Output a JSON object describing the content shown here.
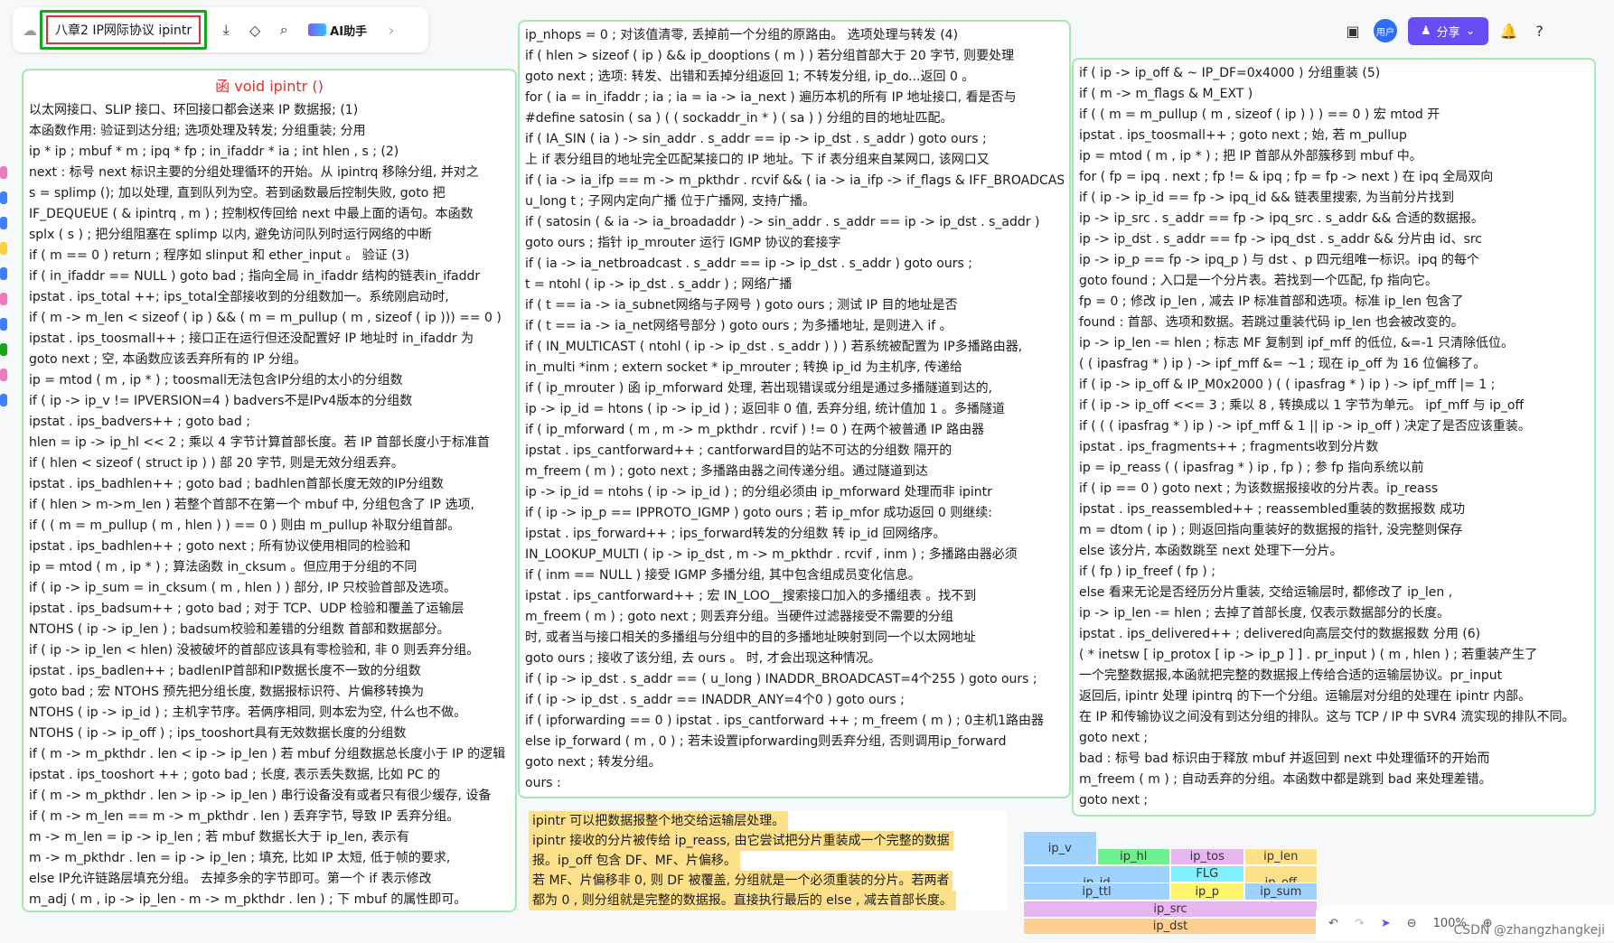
{
  "toolbar": {
    "doc_title": "八章2 IP网际协议 ipintr",
    "ai_label": "AI助手",
    "share_label": "分享",
    "avatar_label": "用户"
  },
  "zoom": "100%",
  "watermark": "CSDN @zhangzhangkeji",
  "left_card": {
    "title": "函 void  ipintr   ()",
    "lines": [
      "以太网接口、SLIP 接口、环回接口都会送来 IP 数据报;                  (1)",
      "本函数作用: 验证到达分组; 选项处理及转发; 分组重装; 分用",
      "ip * ip ; mbuf * m ; ipq * fp ; in_ifaddr * ia ; int  hlen , s ;   (2)",
      "next : 标号 next 标识主要的分组处理循环的开始。从 ipintrq 移除分组, 并对之",
      "s = splimp (); 加以处理, 直到队列为空。若到函数最后控制失败, goto 把",
      "IF_DEQUEUE ( & ipintrq , m ) ;  控制权传回给 next 中最上面的语句。本函数",
      "splx ( s ) ; 把分组阻塞在 splimp 以内, 避免访问队列时运行网络的中断",
      "if ( m == 0 )   return ;     程序如 slinput 和 ether_input  。  验证  (3)",
      "if ( in_ifaddr == NULL ) goto bad ; 指向全局 in_ifaddr 结构的链表in_ifaddr",
      "ipstat . ips_total ++;    ips_total全部接收到的分组数加一。系统刚启动时,",
      "if ( m -> m_len < sizeof ( ip ) && ( m = m_pullup ( m , sizeof ( ip ))) == 0 )",
      "   ipstat . ips_toosmall++ ; 接口正在运行但还没配置好 IP 地址时 in_ifaddr 为",
      "   goto  next ;                  空, 本函数应该丢弃所有的 IP 分组。",
      "ip = mtod ( m , ip * ) ;      toosmall无法包含IP分组的太小的分组数",
      "if ( ip -> ip_v != IPVERSION=4 )    badvers不是IPv4版本的分组数",
      "   ipstat . ips_badvers++ ;       goto  bad ;",
      "hlen = ip -> ip_hl << 2 ; 乘以 4 字节计算首部长度。若 IP 首部长度小于标准首",
      "if ( hlen < sizeof ( struct  ip ) )               部 20 字节, 则是无效分组丢弃。",
      "   ipstat . ips_badhlen++ ;   goto   bad ; badhlen首部长度无效的IP分组数",
      "if ( hlen > m->m_len ) 若整个首部不在第一个 mbuf 中, 分组包含了 IP 选项,",
      "    if ( ( m = m_pullup ( m , hlen ) ) == 0 )  则由 m_pullup 补取分组首部。",
      "      ipstat . ips_badhlen++ ;  goto  next ;   所有协议使用相同的检验和",
      "   ip = mtod ( m , ip * ) ;       算法函数 in_cksum 。但应用于分组的不同",
      "if ( ip -> ip_sum = in_cksum ( m , hlen ) ) 部分, IP 只校验首部及选项。",
      "   ipstat . ips_badsum++ ;  goto   bad ; 对于 TCP、UDP 检验和覆盖了运输层",
      "NTOHS ( ip -> ip_len ) ;   badsum校验和差错的分组数 首部和数据部分。",
      " if ( ip -> ip_len < hlen)   没被破坏的首部应该具有零检验和, 非 0 则丢弃分组。",
      "   ipstat . ips_badlen++ ;    badlenIP首部和IP数据长度不一致的分组数",
      "   goto  bad ;       宏 NTOHS 预先把分组长度, 数据报标识符、片偏移转换为",
      "NTOHS ( ip -> ip_id ) ;  主机字节序。若俩序相同, 则本宏为空, 什么也不做。",
      "NTOHS ( ip -> ip_off ) ;      ips_tooshort具有无效数据长度的分组数",
      "if ( m -> m_pkthdr . len < ip -> ip_len ) 若 mbuf 分组数据总长度小于 IP 的逻辑",
      "   ipstat . ips_tooshort ++ ;   goto   bad ; 长度, 表示丢失数据, 比如 PC 的",
      "if ( m -> m_pkthdr . len > ip -> ip_len ) 串行设备没有或者只有很少缓存, 设备",
      "   if ( m -> m_len == m -> m_pkthdr . len )  丢弃字节, 导致 IP 丢弃分组。",
      "         m -> m_len = ip -> ip_len ;    若 mbuf 数据长大于 ip_len, 表示有",
      "         m -> m_pkthdr . len = ip -> ip_len ; 填充, 比如 IP 太短, 低于帧的要求,",
      "     else        IP允许链路层填充分组。   去掉多余的字节即可。第一个 if 表示修改",
      "         m_adj ( m , ip -> ip_len - m -> m_pkthdr . len ) ; 下 mbuf 的属性即可。"
    ]
  },
  "mid_card": {
    "lines": [
      "ip_nhops = 0 ; 对该值清零, 丢掉前一个分组的原路由。        选项处理与转发 (4)",
      "if ( hlen > sizeof ( ip ) && ip_dooptions ( m ) ) 若分组首部大于 20 字节, 则要处理",
      "    goto  next ;   选项: 转发、出错和丢掉分组返回 1; 不转发分组, ip_do...返回 0 。",
      "for ( ia = in_ifaddr ; ia ; ia = ia -> ia_next ) 遍历本机的所有 IP 地址接口, 看是否与",
      "    #define  satosin ( sa ) ( ( sockaddr_in * ) ( sa ) )      分组的目的地址匹配。",
      "    if ( IA_SIN ( ia ) -> sin_addr . s_addr == ip -> ip_dst . s_addr )   goto  ours ;",
      "  上 if 表分组目的地址完全匹配某接口的 IP 地址。下 if 表分组来自某网口, 该网口又",
      "    if ( ia -> ia_ifp == m -> m_pkthdr . rcvif && ( ia -> ia_ifp -> if_flags & IFF_BROADCAST ) )",
      "         u_long t ;        子网内定向广播      位于广播网, 支持广播。",
      "      if ( satosin ( & ia -> ia_broadaddr ) -> sin_addr . s_addr == ip -> ip_dst . s_addr )",
      "         goto  ours ;                         指针 ip_mrouter 运行 IGMP 协议的套接字",
      "      if ( ia -> ia_netbroadcast . s_addr == ip -> ip_dst . s_addr )    goto   ours ;",
      "      t = ntohl ( ip -> ip_dst . s_addr ) ;         网络广播",
      "      if ( t == ia -> ia_subnet网络与子网号 )     goto   ours ; 测试 IP 目的地址是否",
      "      if ( t == ia -> ia_net网络号部分 )     goto  ours ; 为多播地址, 是则进入 if 。",
      "if ( IN_MULTICAST ( ntohl ( ip -> ip_dst . s_addr ) ) )     若系统被配置为 IP多播路由器,",
      "    in_multi *inm ;  extern  socket * ip_mrouter ;        转换 ip_id 为主机序, 传递给",
      "    if ( ip_mrouter ) 函 ip_mforward 处理, 若出现错误或分组是通过多播隧道到达的,",
      "        ip -> ip_id = htons ( ip -> ip_id ) ;   返回非 0 值, 丢弃分组, 统计值加 1 。多播隧道",
      "        if ( ip_mforward ( m , m -> m_pkthdr . rcvif ) != 0 ) 在两个被普通 IP 路由器",
      "            ipstat . ips_cantforward++ ; cantforward目的站不可达的分组数   隔开的",
      "            m_freem ( m ) ;     goto   next ;  多播路由器之间传递分组。通过隧道到达",
      "        ip -> ip_id = ntohs ( ip -> ip_id ) ;  的分组必须由 ip_mforward 处理而非 ipintr",
      "        if ( ip -> ip_p == IPPROTO_IGMP )     goto   ours ; 若 ip_mfor 成功返回 0 则继续:",
      "        ipstat . ips_forward++ ; ips_forward转发的分组数  转 ip_id 回网络序。",
      "    IN_LOOKUP_MULTI ( ip -> ip_dst , m -> m_pkthdr . rcvif , inm ) ; 多播路由器必须",
      "    if ( inm == NULL )               接受 IGMP 多播分组, 其中包含组成员变化信息。",
      "        ipstat . ips_cantforward++ ; 宏 IN_LOO__搜索接口加入的多播组表  。找不到",
      "        m_freem ( m ) ;   goto   next ; 则丢弃分组。当硬件过滤器接受不需要的分组",
      "    时, 或者当与接口相关的多播组与分组中的目的多播地址映射到同一个以太网地址",
      "    goto   ours ;       接收了该分组, 去 ours 。          时, 才会出现这种情况。",
      "if ( ip -> ip_dst . s_addr == ( u_long ) INADDR_BROADCAST=4个255 )   goto  ours ;",
      "if ( ip -> ip_dst . s_addr == INADDR_ANY=4个0 )    goto  ours ;",
      "if ( ipforwarding == 0 ) ipstat . ips_cantforward ++ ; m_freem ( m ) ; 0主机1路由器",
      "else      ip_forward ( m , 0 ) ; 若未设置ipforwarding则丢弃分组, 否则调用ip_forward",
      "goto   next ;     转发分组。",
      "ours :"
    ]
  },
  "right_card": {
    "lines": [
      "if ( ip -> ip_off & ~ IP_DF=0x4000 ) 分组重装 (5)",
      "   if ( m -> m_flags & M_EXT )",
      "      if ( ( m = m_pullup ( m , sizeof ( ip ) ) ) == 0 ) 宏 mtod 开",
      "        ipstat . ips_toosmall++ ;   goto  next ; 始, 若 m_pullup",
      "      ip = mtod ( m , ip * ) ;        把 IP 首部从外部簇移到 mbuf 中。",
      "   for ( fp = ipq . next ; fp != & ipq ; fp = fp -> next ) 在 ipq 全局双向",
      "      if ( ip -> ip_id == fp -> ipq_id &&    链表里搜索, 为当前分片找到",
      "        ip -> ip_src . s_addr == fp -> ipq_src . s_addr &&    合适的数据报。",
      "        ip -> ip_dst . s_addr == fp -> ipq_dst . s_addr &&    分片由 id、src",
      "        ip -> ip_p == fp -> ipq_p )   与 dst 、p 四元组唯一标识。ipq 的每个",
      "            goto  found ;      入口是一个分片表。若找到一个匹配, fp 指向它。",
      "   fp = 0 ;      修改 ip_len , 减去 IP 标准首部和选项。标准 ip_len 包含了",
      "found :        首部、选项和数据。若跳过重装代码 ip_len 也会被改变的。",
      "   ip -> ip_len -= hlen ; 标志 MF 复制到 ipf_mff 的低位, &=-1 只清除低位。",
      "   ( ( ipasfrag * ) ip ) -> ipf_mff &= ~1 ; 现在 ip_off 为 16 位偏移了。",
      "   if ( ip -> ip_off & IP_M0x2000 )      ( ( ipasfrag  * ) ip ) -> ipf_mff |= 1 ;",
      "   if ( ip -> ip_off <<= 3 ;    乘以 8 , 转换成以 1 字节为单元。 ipf_mff 与 ip_off",
      "   if ( ( ( ipasfrag * ) ip ) -> ipf_mff & 1 || ip -> ip_off )   决定了是否应该重装。",
      "      ipstat . ips_fragments++ ; fragments收到分片数",
      "      ip = ip_reass ( ( ipasfrag * ) ip , fp ) ;     参 fp 指向系统以前",
      "      if ( ip == 0 )       goto   next ;       为该数据报接收的分片表。ip_reass",
      "      ipstat . ips_reassembled++ ; reassembled重装的数据报数   成功",
      "      m = dtom ( ip ) ; 则返回指向重装好的数据报的指针, 没完整则保存",
      "   else                  该分片, 本函数跳至 next 处理下一分片。",
      "      if ( fp )      ip_freef ( fp ) ;",
      "else          看来无论是否经历分片重装, 交给运输层时, 都修改了 ip_len ,",
      "   ip -> ip_len -= hlen ;   去掉了首部长度, 仅表示数据部分的长度。",
      "ipstat . ips_delivered++ ; delivered向高层交付的数据报数        分用 (6)",
      "( * inetsw [ ip_protox [ ip -> ip_p ] ] . pr_input ) ( m , hlen ) ;  若重装产生了",
      "一个完整数据报,本函就把完整的数据报上传给合适的运输层协议。pr_input",
      "返回后, ipintr 处理 ipintrq 的下一个分组。运输层对分组的处理在 ipintr 内部。",
      "在 IP 和传输协议之间没有到达分组的排队。这与 TCP / IP 中 SVR4 流实现的排队不同。",
      "goto   next ;",
      "bad : 标号 bad 标识由于释放 mbuf 并返回到 next 中处理循环的开始而",
      "m_freem ( m ) ; 自动丢弃的分组。本函数中都是跳到 bad 来处理差错。",
      "goto   next ;"
    ]
  },
  "note": {
    "lines": [
      "ipintr 可以把数据报整个地交给运输层处理。",
      "ipintr 接收的分片被传给 ip_reass, 由它尝试把分片重装成一个完整的数据",
      "报。ip_off 包含 DF、MF、片偏移。",
      "若 MF、片偏移非 0, 则 DF 被覆盖, 分组就是一个必须重装的分片。若两者",
      "都为 0 , 则分组就是完整的数据报。直接执行最后的 else , 减去首部长度。"
    ]
  },
  "ip_header": {
    "cells": [
      {
        "label": "ip_v",
        "color": "#9fd2ff"
      },
      {
        "label": "ip_hl",
        "color": "#6ff08f"
      },
      {
        "label": "ip_tos",
        "color": "#e7b6f0"
      },
      {
        "label": "ip_len",
        "color": "#ffe08a"
      },
      {
        "label": "ip_id",
        "color": "#9fd2ff"
      },
      {
        "label": "FLG",
        "color": "#7ff0ff"
      },
      {
        "label": "ip_off",
        "color": "#ffe08a"
      },
      {
        "label": "ip_ttl",
        "color": "#9fd2ff"
      },
      {
        "label": "ip_p",
        "color": "#fff46b"
      },
      {
        "label": "ip_sum",
        "color": "#9fd2ff"
      },
      {
        "label": "ip_src",
        "color": "#e7b6f0"
      },
      {
        "label": "ip_dst",
        "color": "#ffcf8f"
      }
    ]
  }
}
